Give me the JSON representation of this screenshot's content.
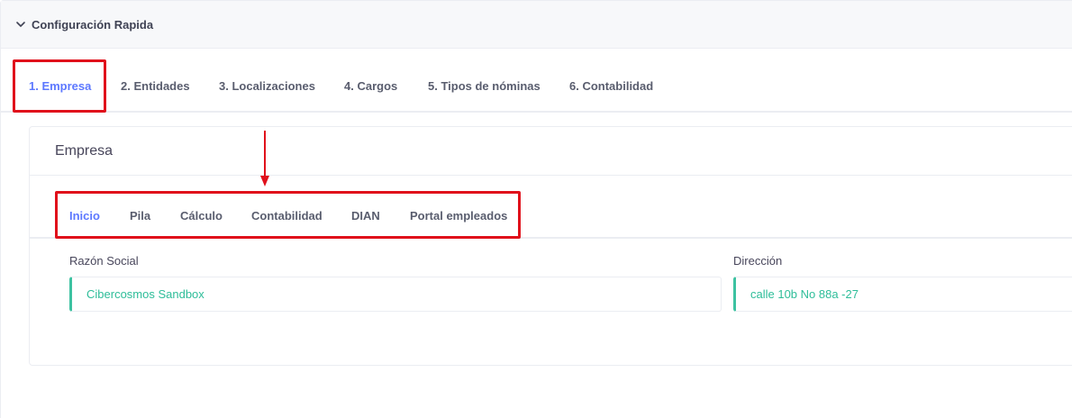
{
  "quick_config": {
    "title": "Configuración Rapida"
  },
  "main_tabs": [
    {
      "label": "1. Empresa",
      "active": true
    },
    {
      "label": "2. Entidades",
      "active": false
    },
    {
      "label": "3. Localizaciones",
      "active": false
    },
    {
      "label": "4. Cargos",
      "active": false
    },
    {
      "label": "5. Tipos de nóminas",
      "active": false
    },
    {
      "label": "6. Contabilidad",
      "active": false
    }
  ],
  "empresa": {
    "title": "Empresa",
    "sub_tabs": [
      {
        "label": "Inicio",
        "active": true
      },
      {
        "label": "Pila",
        "active": false
      },
      {
        "label": "Cálculo",
        "active": false
      },
      {
        "label": "Contabilidad",
        "active": false
      },
      {
        "label": "DIAN",
        "active": false
      },
      {
        "label": "Portal empleados",
        "active": false
      }
    ],
    "fields": {
      "razon_social": {
        "label": "Razón Social",
        "value": "Cibercosmos Sandbox"
      },
      "direccion": {
        "label": "Dirección",
        "value": "calle 10b No 88a -27"
      }
    }
  },
  "colors": {
    "active_tab": "#5d78ff",
    "input_accent": "#3dc2a1",
    "annotation": "#e0101b"
  },
  "icons": {
    "collapse": "chevron-down-icon",
    "annotation_arrow": "arrow-down-icon"
  }
}
